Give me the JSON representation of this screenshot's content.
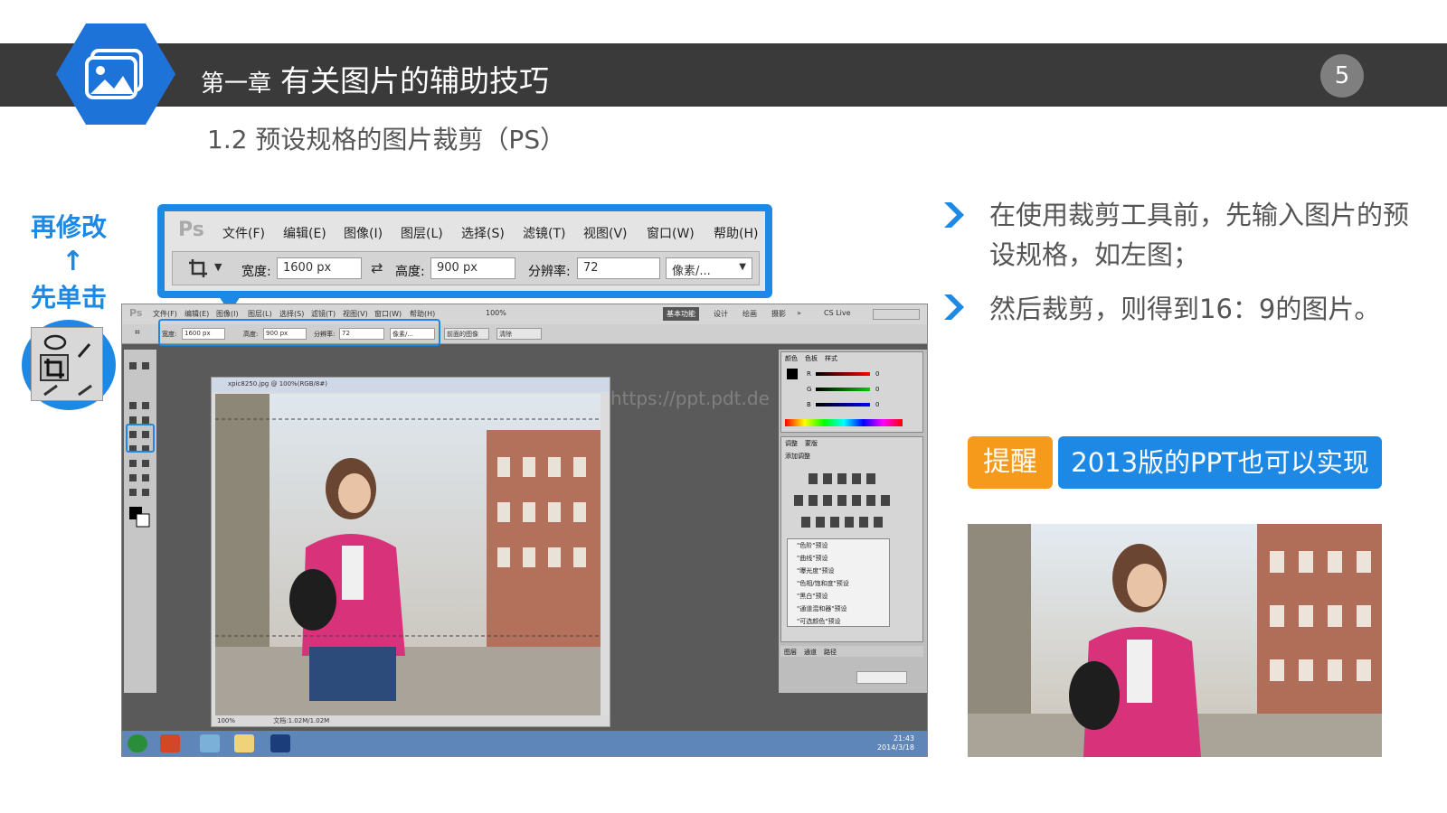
{
  "header": {
    "chapter_prefix": "第一章",
    "chapter_title": "有关图片的辅助技巧",
    "page_number": "5"
  },
  "subtitle": "1.2 预设规格的图片裁剪（PS）",
  "callout": {
    "line1": "再修改",
    "arrow": "↑",
    "line2": "先单击"
  },
  "zoomed_toolbar": {
    "logo": "Ps",
    "menu": [
      "文件(F)",
      "编辑(E)",
      "图像(I)",
      "图层(L)",
      "选择(S)",
      "滤镜(T)",
      "视图(V)",
      "窗口(W)",
      "帮助(H)"
    ],
    "width_label": "宽度:",
    "width_value": "1600 px",
    "height_label": "高度:",
    "height_value": "900 px",
    "resolution_label": "分辨率:",
    "resolution_value": "72",
    "unit_value": "像素/..."
  },
  "ps_window": {
    "menu": [
      "文件(F)",
      "编辑(E)",
      "图像(I)",
      "图层(L)",
      "选择(S)",
      "滤镜(T)",
      "视图(V)",
      "窗口(W)",
      "帮助(H)"
    ],
    "zoom": "100%",
    "workspace_buttons": [
      "基本功能",
      "设计",
      "绘画",
      "摄影",
      "»"
    ],
    "cs_live": "CS Live",
    "option_width_label": "宽度:",
    "option_width": "1600 px",
    "option_height_label": "高度:",
    "option_height": "900 px",
    "option_res_label": "分辨率:",
    "option_res": "72",
    "option_unit": "像素/...",
    "front_image_button": "前面的图像",
    "clear_button": "清除",
    "doc_title": "xpic8250.jpg @ 100%(RGB/8#)",
    "doc_zoom": "100%",
    "doc_info": "文档:1.02M/1.02M",
    "watermark": "https://ppt.pdt.de",
    "panel_tabs": [
      "颜色",
      "色板",
      "样式"
    ],
    "rgb_labels": [
      "R",
      "G",
      "B"
    ],
    "rgb_values": [
      "0",
      "0",
      "0"
    ],
    "adjust_tabs": [
      "调整",
      "蒙版"
    ],
    "adjust_heading": "添加调整",
    "adjust_presets": [
      "\"色阶\"预设",
      "\"曲线\"预设",
      "\"曝光度\"预设",
      "\"色相/饱和度\"预设",
      "\"黑白\"预设",
      "\"通道混和器\"预设",
      "\"可选颜色\"预设"
    ],
    "layer_tabs": [
      "图层",
      "通道",
      "路径"
    ],
    "clock_time": "21:43",
    "clock_date": "2014/3/18"
  },
  "bullets": [
    "在使用裁剪工具前，先输入图片的预设规格，如左图；",
    "然后裁剪，则得到16：9的图片。"
  ],
  "reminder": {
    "tag": "提醒",
    "text": "2013版的PPT也可以实现"
  },
  "colors": {
    "accent_blue": "#1e88e5",
    "accent_orange": "#f59a1b",
    "title_bar": "#3a3a3a"
  },
  "icons": [
    "picture-icon",
    "crop-icon",
    "chevron-right-icon",
    "swap-icon",
    "dropdown-icon",
    "lasso-icon",
    "eyedropper-icon"
  ]
}
